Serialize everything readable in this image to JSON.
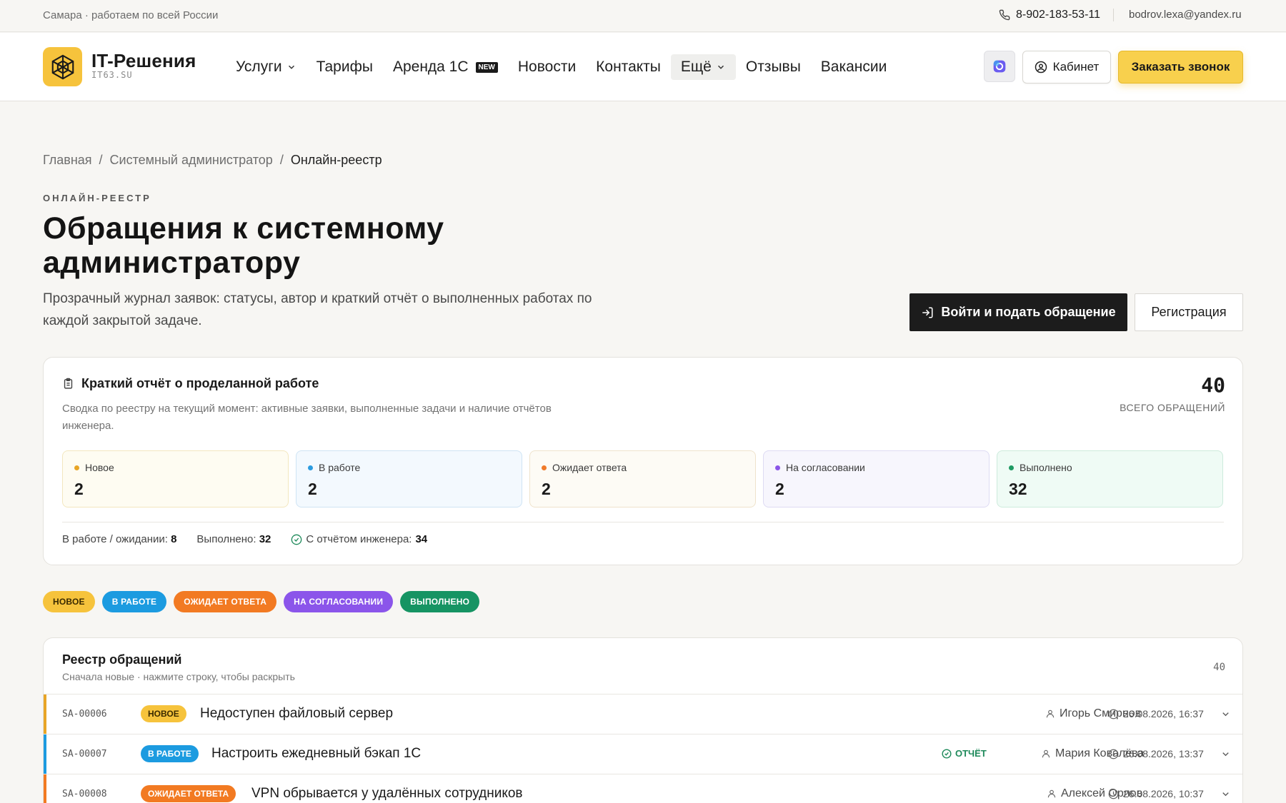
{
  "topbar": {
    "location": "Самара · работаем по всей России",
    "phone": "8-902-183-53-11",
    "email": "bodrov.lexa@yandex.ru"
  },
  "header": {
    "logo_title": "IT-Решения",
    "logo_sub": "IT63.SU",
    "nav": [
      {
        "label": "Услуги"
      },
      {
        "label": "Тарифы"
      },
      {
        "label": "Аренда 1С",
        "badge": "NEW"
      },
      {
        "label": "Новости"
      },
      {
        "label": "Контакты"
      },
      {
        "label": "Ещё"
      },
      {
        "label": "Отзывы"
      },
      {
        "label": "Вакансии"
      }
    ],
    "cabinet_label": "Кабинет",
    "call_label": "Заказать звонок"
  },
  "breadcrumb": [
    "Главная",
    "Системный администратор",
    "Онлайн-реестр"
  ],
  "hero": {
    "eyebrow": "ОНЛАЙН-РЕЕСТР",
    "title_line1": "Обращения к системному",
    "title_line2": "администратору",
    "lead_line1": "Прозрачный журнал заявок: статусы, автор и краткий отчёт о выполненных работах по",
    "lead_line2": "каждой закрытой задаче.",
    "login_label": "Войти и подать обращение",
    "register_label": "Регистрация"
  },
  "report": {
    "title": "Краткий отчёт о проделанной работе",
    "desc_line1": "Сводка по реестру на текущий момент: активные заявки, выполненные задачи и наличие отчётов",
    "desc_line2": "инженера.",
    "total": "40",
    "total_label": "ВСЕГО ОБРАЩЕНИЙ",
    "stats": [
      {
        "label": "Новое",
        "value": "2",
        "color": "#e8a526"
      },
      {
        "label": "В работе",
        "value": "2",
        "color": "#2b9bdf"
      },
      {
        "label": "Ожидает ответа",
        "value": "2",
        "color": "#f07a2a"
      },
      {
        "label": "На согласовании",
        "value": "2",
        "color": "#8a55e8"
      },
      {
        "label": "Выполнено",
        "value": "32",
        "color": "#1f9a63"
      }
    ],
    "foot": {
      "inwork_label": "В работе / ожидании:",
      "inwork_value": "8",
      "done_label": "Выполнено:",
      "done_value": "32",
      "report_label": "С отчётом инженера:",
      "report_value": "34"
    }
  },
  "filters": [
    {
      "label": "НОВОЕ",
      "bg": "#f6c33c",
      "fg": "#3a2a00"
    },
    {
      "label": "В РАБОТЕ",
      "bg": "#1c9be0",
      "fg": "#ffffff"
    },
    {
      "label": "ОЖИДАЕТ ОТВЕТА",
      "bg": "#f27a22",
      "fg": "#ffffff"
    },
    {
      "label": "НА СОГЛАСОВАНИИ",
      "bg": "#8b55ea",
      "fg": "#ffffff"
    },
    {
      "label": "ВЫПОЛНЕНО",
      "bg": "#169463",
      "fg": "#ffffff"
    }
  ],
  "registry": {
    "title": "Реестр обращений",
    "subtitle": "Сначала новые · нажмите строку, чтобы раскрыть",
    "count": "40",
    "report_tag": "ОТЧЁТ",
    "rows": [
      {
        "id": "SA-00006",
        "status": "НОВОЕ",
        "title": "Недоступен файловый сервер",
        "author": "Игорь Смирнов",
        "date": "26.08.2026, 16:37",
        "color": "#e8a526"
      },
      {
        "id": "SA-00007",
        "status": "В РАБОТЕ",
        "title": "Настроить ежедневный бэкап 1С",
        "author": "Мария Ковалёва",
        "date": "26.08.2026, 13:37",
        "color": "#1c9be0"
      },
      {
        "id": "SA-00008",
        "status": "ОЖИДАЕТ ОТВЕТА",
        "title": "VPN обрывается у удалённых сотрудников",
        "author": "Алексей Орлов",
        "date": "26.08.2026, 10:37",
        "color": "#f27a22"
      }
    ]
  }
}
